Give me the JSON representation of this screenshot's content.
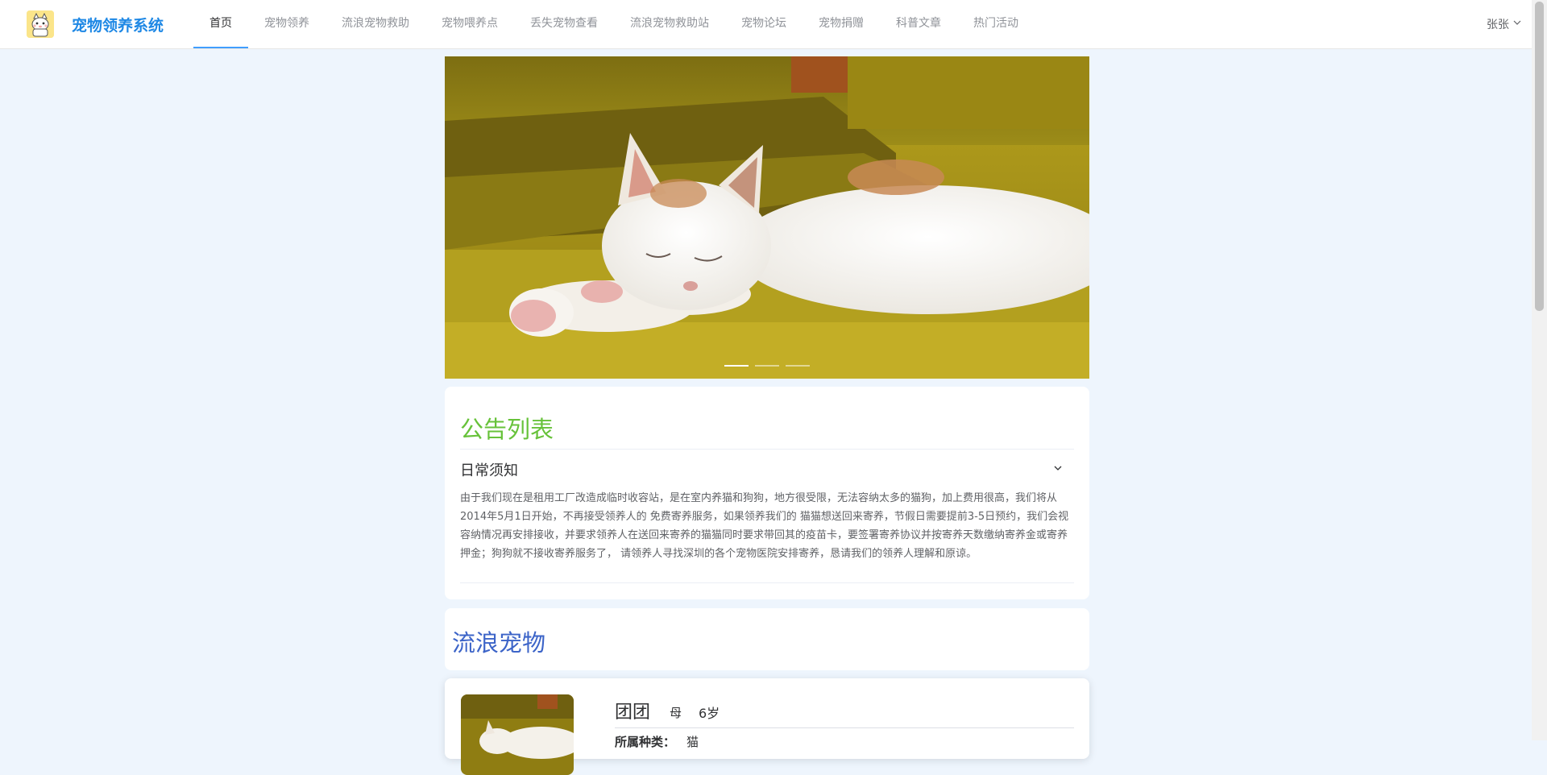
{
  "app": {
    "title": "宠物领养系统"
  },
  "nav": {
    "items": [
      {
        "label": "首页",
        "active": true
      },
      {
        "label": "宠物领养"
      },
      {
        "label": "流浪宠物救助"
      },
      {
        "label": "宠物喂养点"
      },
      {
        "label": "丢失宠物查看"
      },
      {
        "label": "流浪宠物救助站"
      },
      {
        "label": "宠物论坛"
      },
      {
        "label": "宠物捐赠"
      },
      {
        "label": "科普文章"
      },
      {
        "label": "热门活动"
      }
    ]
  },
  "user": {
    "name": "张张"
  },
  "carousel": {
    "slides": 3,
    "active_index": 0
  },
  "notice": {
    "title": "公告列表",
    "item_title": "日常须知",
    "item_text": "由于我们现在是租用工厂改造成临时收容站，是在室内养猫和狗狗，地方很受限，无法容纳太多的猫狗，加上费用很高，我们将从2014年5月1日开始，不再接受领养人的 免费寄养服务，如果领养我们的 猫猫想送回来寄养，节假日需要提前3-5日预约，我们会视容纳情况再安排接收，并要求领养人在送回来寄养的猫猫同时要求带回其的疫苗卡，要签署寄养协议并按寄养天数缴纳寄养金或寄养押金；狗狗就不接收寄养服务了， 请领养人寻找深圳的各个宠物医院安排寄养，恳请我们的领养人理解和原谅。"
  },
  "stray": {
    "title": "流浪宠物",
    "pets": [
      {
        "name": "团团",
        "gender": "母",
        "age": "6岁",
        "species_label": "所属种类：",
        "species": "猫"
      }
    ]
  },
  "colors": {
    "accent": "#409eff",
    "logo_text": "#1e88e5",
    "notice_title": "#67c23a",
    "stray_title": "#3c64c8"
  },
  "icons": {
    "logo": "cat-logo-icon",
    "dropdown": "chevron-down-icon",
    "collapse": "chevron-down-icon"
  }
}
